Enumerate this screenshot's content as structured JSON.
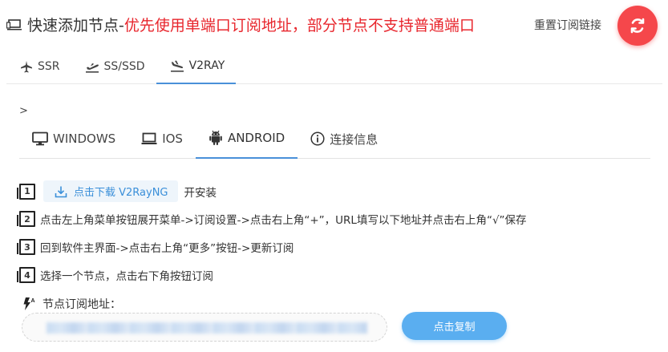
{
  "header": {
    "title_prefix": "快速添加节点-",
    "title_warning": "优先使用单端口订阅地址，部分节点不支持普通端口",
    "reset_link": "重置订阅链接",
    "refresh_icon": "refresh-icon",
    "warning_color": "#e8262d",
    "refresh_color": "#f5474b"
  },
  "main_tabs": [
    {
      "label": "SSR",
      "icon": "airplane-icon",
      "active": false
    },
    {
      "label": "SS/SSD",
      "icon": "airplane-takeoff-icon",
      "active": false
    },
    {
      "label": "V2RAY",
      "icon": "airplane-landing-icon",
      "active": true
    }
  ],
  "breadcrumb": ">",
  "os_tabs": [
    {
      "label": "WINDOWS",
      "icon": "monitor-icon",
      "active": false
    },
    {
      "label": "IOS",
      "icon": "laptop-icon",
      "active": false
    },
    {
      "label": "ANDROID",
      "icon": "android-icon",
      "active": true
    },
    {
      "label": "连接信息",
      "icon": "info-icon",
      "active": false
    }
  ],
  "steps": {
    "s1_num": "1",
    "s1_button": "点击下载 V2RayNG",
    "s1_suffix": "开安装",
    "s2_num": "2",
    "s2_text": "点击左上角菜单按钮展开菜单->订阅设置->点击右上角“+”，URL填写以下地址并点击右上角“√”保存",
    "s3_num": "3",
    "s3_text": "回到软件主界面->点击右上角“更多”按钮->更新订阅",
    "s4_num": "4",
    "s4_text": "选择一个节点，点击右下角按钮订阅"
  },
  "subscription": {
    "label": "节点订阅地址：",
    "copy_button": "点击复制",
    "accent_color": "#5aaef0"
  }
}
